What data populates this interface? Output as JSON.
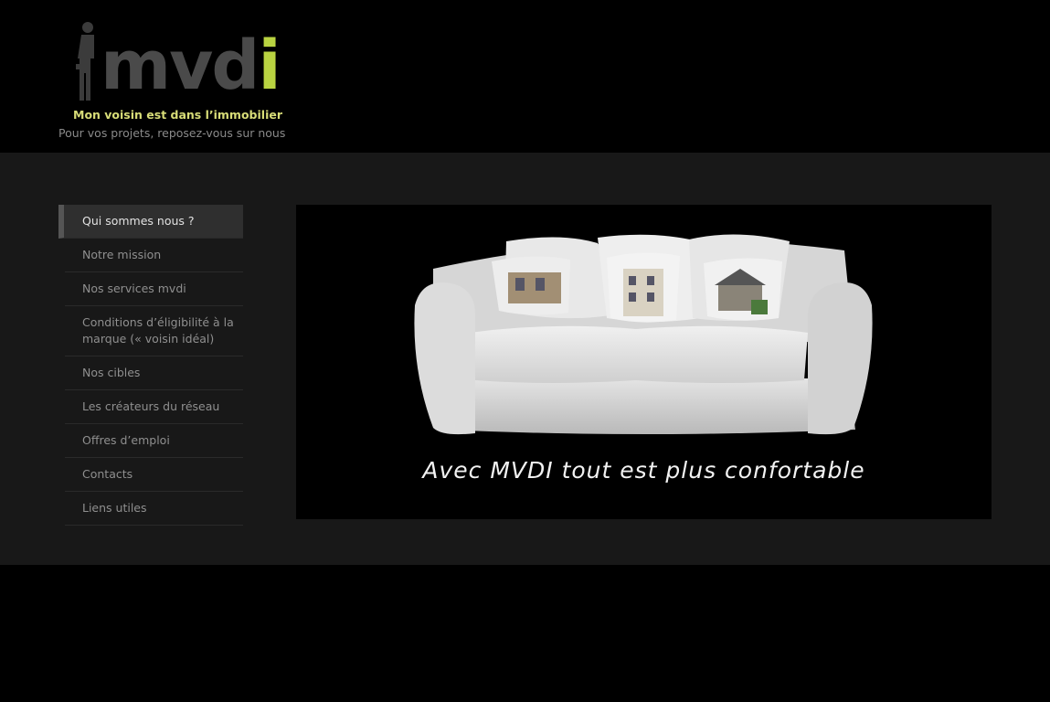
{
  "logo": {
    "word_main": "mvd",
    "word_accent": "i",
    "tagline": "Mon voisin est dans l’immobilier",
    "slogan": "Pour vos projets, reposez-vous sur nous",
    "colors": {
      "word": "#4a4a4a",
      "accent": "#b9d341",
      "tagline": "#d8dd78",
      "slogan": "#8a8a8a"
    }
  },
  "menu": {
    "items": [
      {
        "label": "Qui sommes nous ?",
        "active": true
      },
      {
        "label": "Notre mission"
      },
      {
        "label": "Nos services mvdi"
      },
      {
        "label": "Conditions d’éligibilité à la marque (« voisin idéal)"
      },
      {
        "label": "Nos cibles"
      },
      {
        "label": "Les créateurs du réseau"
      },
      {
        "label": "Offres d’emploi"
      },
      {
        "label": "Contacts"
      },
      {
        "label": "Liens utiles"
      }
    ]
  },
  "hero": {
    "caption": "Avec MVDI tout est plus confortable",
    "image_subject": "sofa-with-house-pillows"
  },
  "colors": {
    "page_bg": "#000000",
    "band_bg": "#181818",
    "menu_text": "#8f8f8f",
    "menu_active_text": "#e2e2e2"
  }
}
